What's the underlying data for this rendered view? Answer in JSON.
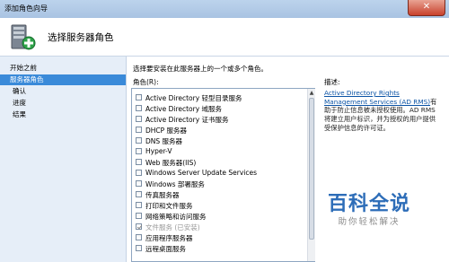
{
  "window": {
    "title": "添加角色向导",
    "close_glyph": "✕"
  },
  "header": {
    "heading": "选择服务器角色",
    "icon": "server-add-icon"
  },
  "nav": {
    "items": [
      {
        "label": "开始之前",
        "selected": false
      },
      {
        "label": "服务器角色",
        "selected": true
      },
      {
        "label": "确认",
        "selected": false
      },
      {
        "label": "进度",
        "selected": false
      },
      {
        "label": "结果",
        "selected": false
      }
    ]
  },
  "main": {
    "intro": "选择要安装在此服务器上的一个或多个角色。",
    "roles_label": "角色(R):",
    "description_label": "描述:",
    "description_link": "Active Directory Rights Management Services (AD RMS)",
    "description_text": "有助于防止信息被未授权使用。AD RMS 将建立用户标识，并为授权的用户提供受保护信息的许可证。",
    "roles": [
      {
        "label": "Active Directory 轻型目录服务",
        "checked": false,
        "disabled": false
      },
      {
        "label": "Active Directory 域服务",
        "checked": false,
        "disabled": false
      },
      {
        "label": "Active Directory 证书服务",
        "checked": false,
        "disabled": false
      },
      {
        "label": "DHCP 服务器",
        "checked": false,
        "disabled": false
      },
      {
        "label": "DNS 服务器",
        "checked": false,
        "disabled": false
      },
      {
        "label": "Hyper-V",
        "checked": false,
        "disabled": false
      },
      {
        "label": "Web 服务器(IIS)",
        "checked": false,
        "disabled": false
      },
      {
        "label": "Windows Server Update Services",
        "checked": false,
        "disabled": false
      },
      {
        "label": "Windows 部署服务",
        "checked": false,
        "disabled": false
      },
      {
        "label": "传真服务器",
        "checked": false,
        "disabled": false
      },
      {
        "label": "打印和文件服务",
        "checked": false,
        "disabled": false
      },
      {
        "label": "网络策略和访问服务",
        "checked": false,
        "disabled": false
      },
      {
        "label": "文件服务  (已安装)",
        "checked": true,
        "disabled": true
      },
      {
        "label": "应用程序服务器",
        "checked": false,
        "disabled": false
      },
      {
        "label": "远程桌面服务",
        "checked": false,
        "disabled": false
      }
    ]
  },
  "watermark": {
    "title": "百科全说",
    "subtitle": "助你轻松解决"
  }
}
